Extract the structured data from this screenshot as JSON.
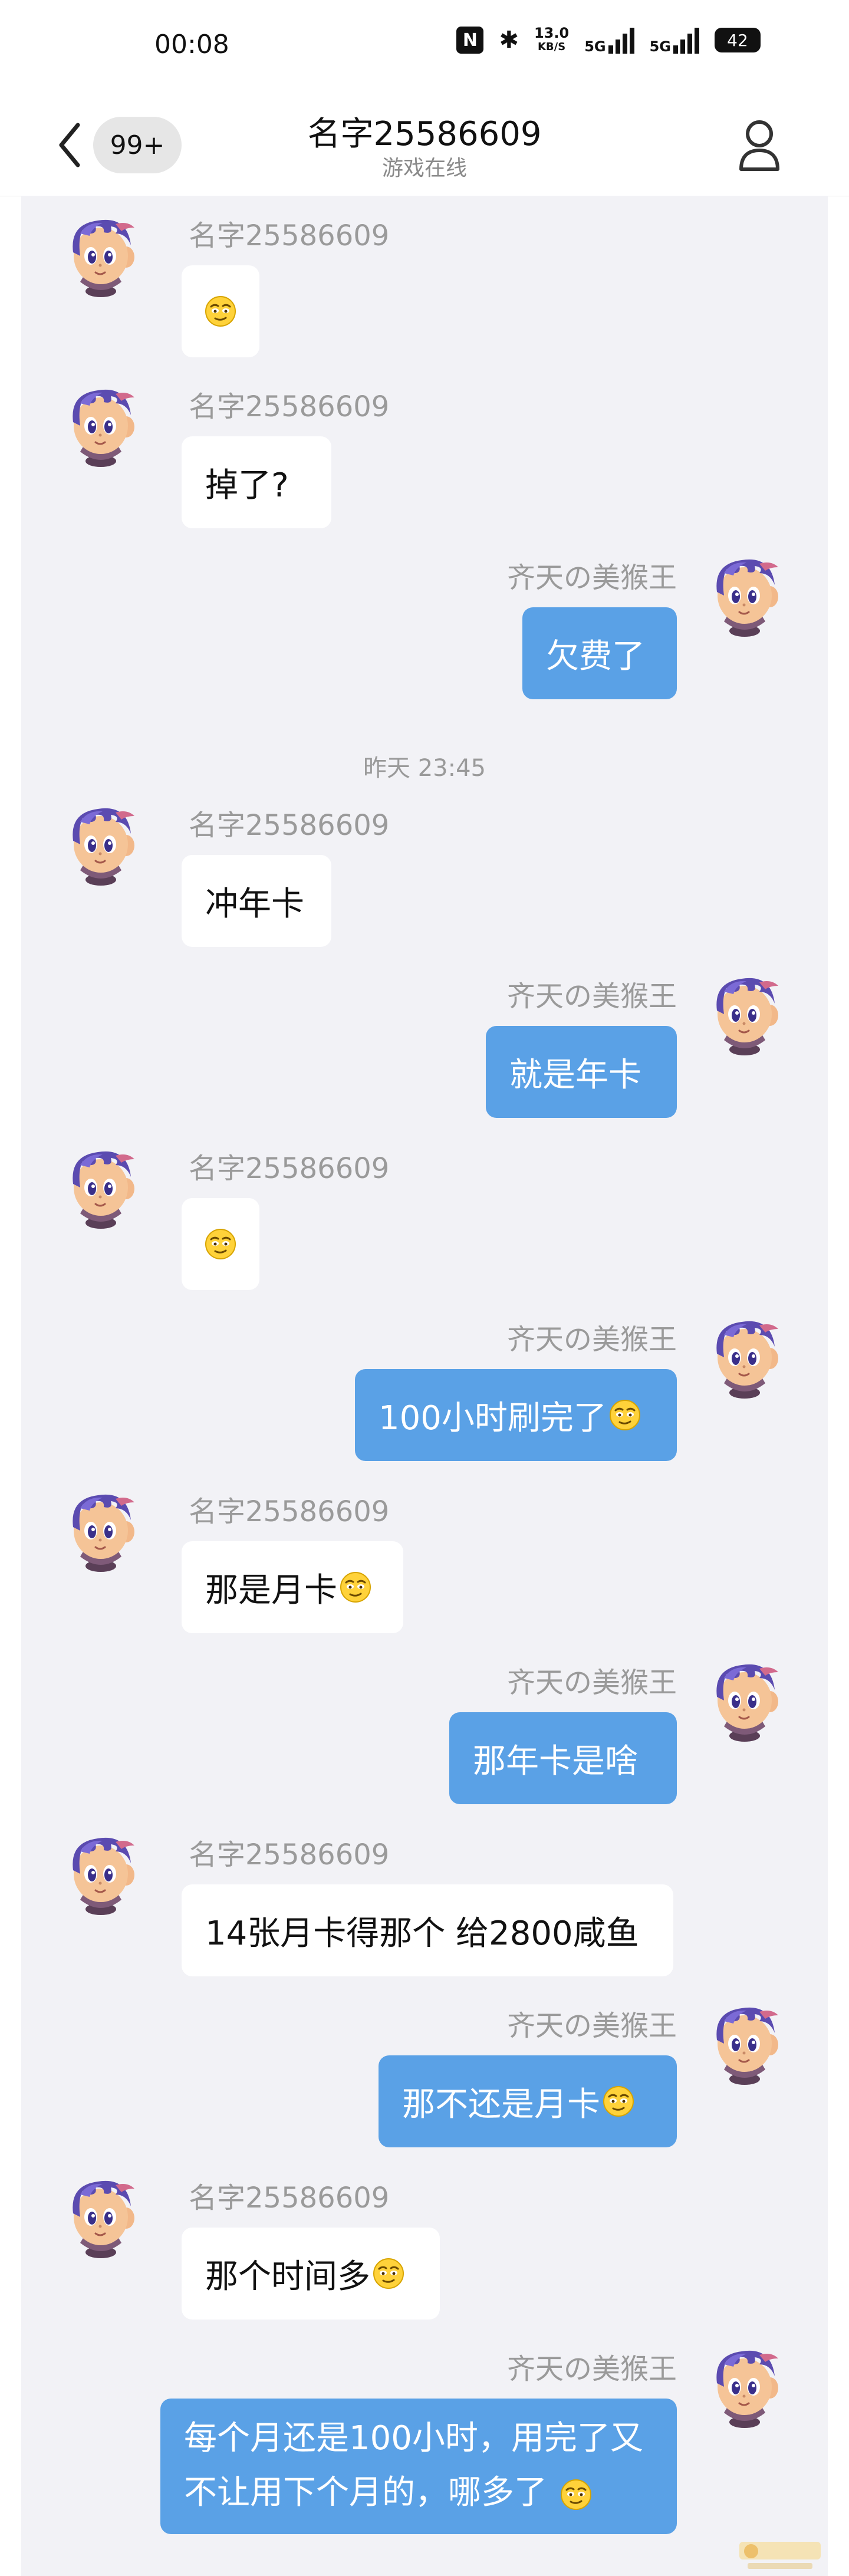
{
  "status_bar": {
    "time": "00:08",
    "net_speed_value": "13.0",
    "net_speed_unit": "KB/S",
    "sim1": "5G",
    "sim2": "5G",
    "battery": "42"
  },
  "header": {
    "unread_badge": "99+",
    "title": "名字25586609",
    "subtitle": "游戏在线"
  },
  "contacts": {
    "other": "名字25586609",
    "me": "齐天の美猴王"
  },
  "divider": {
    "timestamp": "昨天 23:45"
  },
  "messages": [
    {
      "sender": "other",
      "text": "",
      "emoji": true
    },
    {
      "sender": "other",
      "text": "掉了?",
      "emoji": false
    },
    {
      "sender": "me",
      "text": "欠费了",
      "emoji": false
    },
    {
      "sender": "other",
      "text": "冲年卡",
      "emoji": false
    },
    {
      "sender": "me",
      "text": "就是年卡",
      "emoji": false
    },
    {
      "sender": "other",
      "text": "",
      "emoji": true
    },
    {
      "sender": "me",
      "text": "100小时刷完了",
      "emoji": true
    },
    {
      "sender": "other",
      "text": "那是月卡",
      "emoji": true
    },
    {
      "sender": "me",
      "text": "那年卡是啥",
      "emoji": false
    },
    {
      "sender": "other",
      "text": "14张月卡得那个 给2800咸鱼",
      "emoji": false
    },
    {
      "sender": "me",
      "text": "那不还是月卡",
      "emoji": true
    },
    {
      "sender": "other",
      "text": "那个时间多",
      "emoji": true
    },
    {
      "sender": "me",
      "text": "每个月还是100小时，用完了又不让用下个月的，哪多了",
      "emoji": true
    }
  ],
  "colors": {
    "chat_bg": "#f2f2f6",
    "outgoing_bubble": "#5aa1e6",
    "incoming_bubble": "#ffffff",
    "name_text": "#9a9a9a"
  }
}
